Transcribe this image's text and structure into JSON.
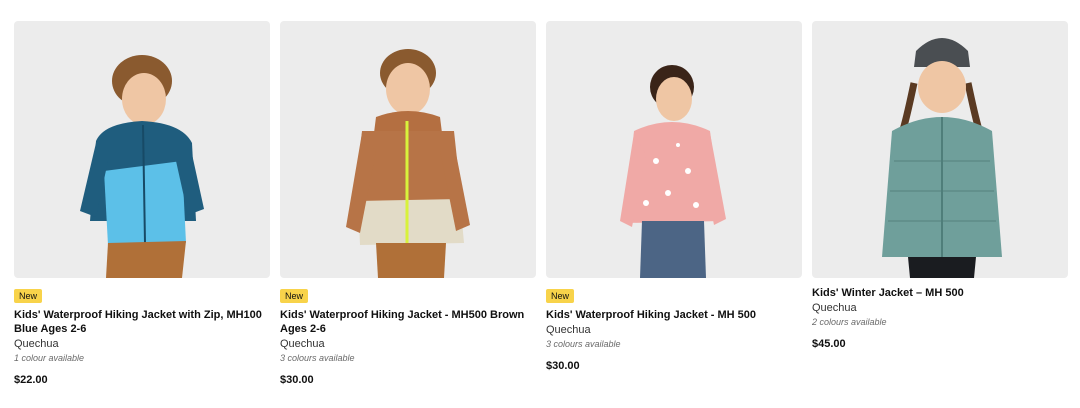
{
  "products": [
    {
      "badge": "New",
      "title": "Kids' Waterproof Hiking Jacket with Zip, MH100 Blue Ages 2-6",
      "brand": "Quechua",
      "colours": "1 colour available",
      "price": "$22.00"
    },
    {
      "badge": "New",
      "title": "Kids' Waterproof Hiking Jacket - MH500 Brown Ages 2-6",
      "brand": "Quechua",
      "colours": "3 colours available",
      "price": "$30.00"
    },
    {
      "badge": "New",
      "title": "Kids' Waterproof Hiking Jacket - MH 500",
      "brand": "Quechua",
      "colours": "3 colours available",
      "price": "$30.00"
    },
    {
      "title": "Kids' Winter Jacket – MH 500",
      "brand": "Quechua",
      "colours": "2 colours available",
      "price": "$45.00"
    }
  ],
  "colors": {
    "badge_bg": "#f8d34a",
    "image_bg": "#ececec"
  }
}
